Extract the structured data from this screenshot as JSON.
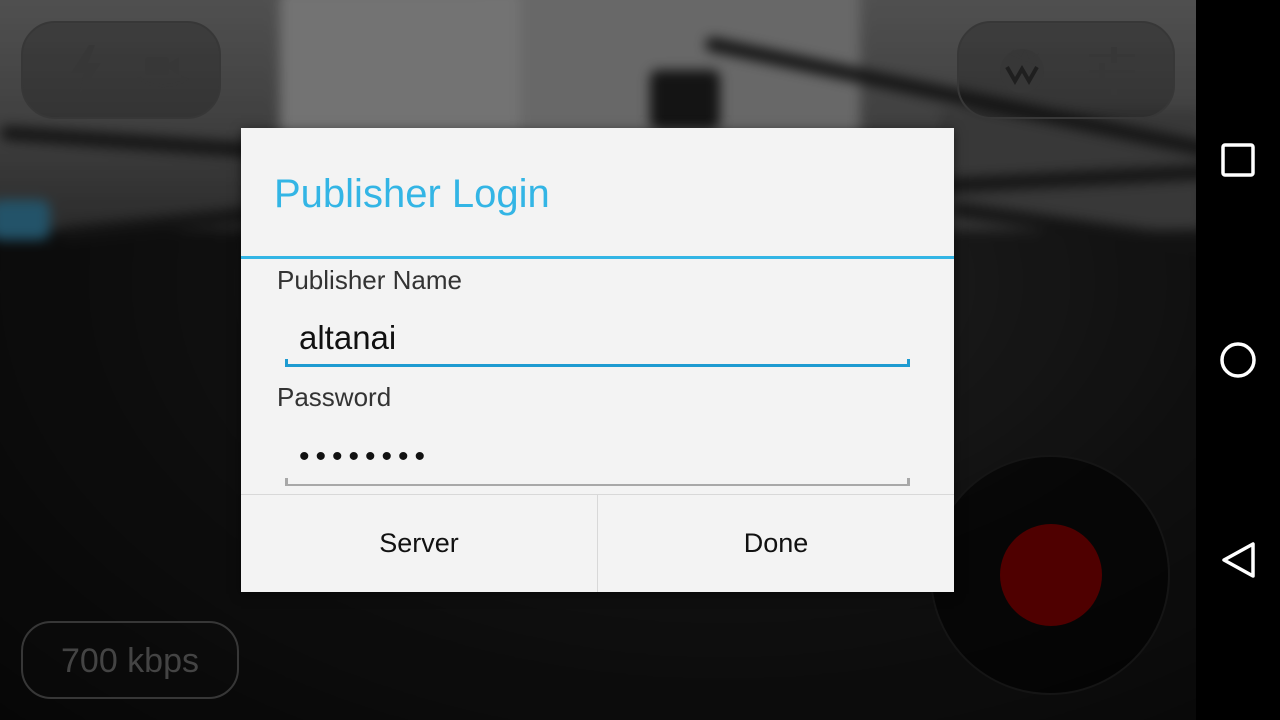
{
  "camera_controls": {
    "flash_icon": "flash-icon",
    "switch_camera_icon": "switch-camera-icon",
    "wowza_icon": "wowza-logo-icon",
    "settings_icon": "settings-sliders-icon",
    "bitrate": "700 kbps"
  },
  "dialog": {
    "title": "Publisher Login",
    "name_label": "Publisher Name",
    "name_value": "altanai",
    "password_label": "Password",
    "password_value": "••••••••",
    "server_button": "Server",
    "done_button": "Done"
  },
  "record_button": {
    "icon": "record-icon"
  },
  "navbar": {
    "recents_icon": "recents-square-icon",
    "home_icon": "home-circle-icon",
    "back_icon": "back-triangle-icon"
  },
  "colors": {
    "accent": "#33b5e5",
    "field_active": "#1e9bd1",
    "record": "#6a0000",
    "dialog_bg": "#f3f3f3"
  }
}
